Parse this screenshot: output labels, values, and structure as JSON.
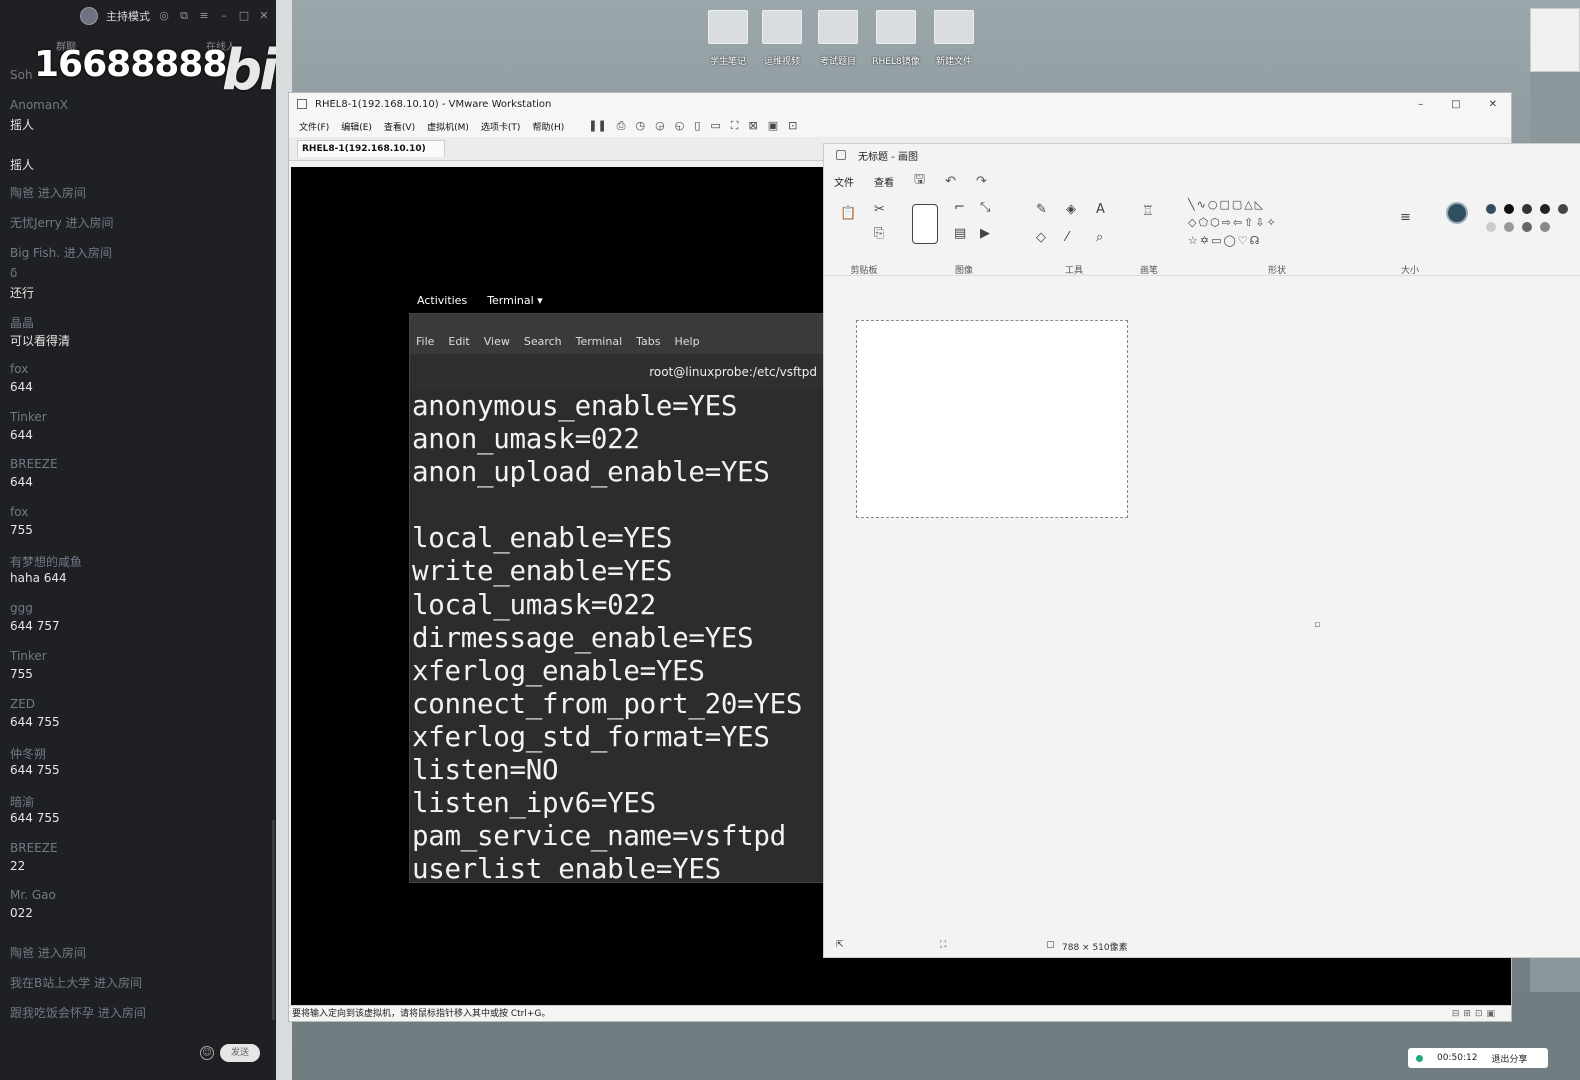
{
  "chat": {
    "header_mode": "主持模式",
    "subtabs": [
      "群聊",
      "在线人"
    ],
    "watermark_number": "16688888",
    "watermark_logo": "bilibili",
    "watermark_prefix": "Soh",
    "messages": [
      {
        "kind": "msg",
        "user": "AnomanX",
        "text": "摇人"
      },
      {
        "kind": "solo",
        "text": "摇人"
      },
      {
        "kind": "sys",
        "text": "陶爸 进入房间"
      },
      {
        "kind": "sys",
        "text": "无忧Jerry 进入房间"
      },
      {
        "kind": "sys",
        "text": "Big Fish. 进入房间"
      },
      {
        "kind": "msg",
        "user": "δ",
        "text": "还行"
      },
      {
        "kind": "msg",
        "user": "晶晶",
        "text": "可以看得清"
      },
      {
        "kind": "msg",
        "user": "fox",
        "text": "644"
      },
      {
        "kind": "msg",
        "user": "Tinker",
        "text": "644"
      },
      {
        "kind": "msg",
        "user": "BREEZE",
        "text": "644"
      },
      {
        "kind": "msg",
        "user": "fox",
        "text": "755"
      },
      {
        "kind": "msg",
        "user": "有梦想的咸鱼",
        "text": "haha 644"
      },
      {
        "kind": "msg",
        "user": "ggg",
        "text": "644 757"
      },
      {
        "kind": "msg",
        "user": "Tinker",
        "text": "755"
      },
      {
        "kind": "msg",
        "user": "ZED",
        "text": "644 755"
      },
      {
        "kind": "msg",
        "user": "仲冬朔",
        "text": "644  755"
      },
      {
        "kind": "msg",
        "user": "暗渝",
        "text": "644 755"
      },
      {
        "kind": "msg",
        "user": "BREEZE",
        "text": "22"
      },
      {
        "kind": "msg",
        "user": "Mr. Gao",
        "text": "022"
      },
      {
        "kind": "sys",
        "text": "陶爸 进入房间"
      },
      {
        "kind": "sys",
        "text": "我在B站上大学 进入房间"
      },
      {
        "kind": "sys",
        "text": "跟我吃饭会怀孕 进入房间"
      }
    ],
    "send_label": "发送"
  },
  "desktop_icons": [
    "学生笔记",
    "运维视频",
    "考试题目",
    "RHEL8镜像",
    "新建文件"
  ],
  "vmware": {
    "title": "RHEL8-1(192.168.10.10) - VMware Workstation",
    "menus": [
      "文件(F)",
      "编辑(E)",
      "查看(V)",
      "虚拟机(M)",
      "选项卡(T)",
      "帮助(H)"
    ],
    "tab": "RHEL8-1(192.168.10.10)",
    "status": "要将输入定向到该虚拟机，请将鼠标指针移入其中或按 Ctrl+G。"
  },
  "gnome": {
    "activities": "Activities",
    "app": "Terminal ▾"
  },
  "terminal": {
    "menus": [
      "File",
      "Edit",
      "View",
      "Search",
      "Terminal",
      "Tabs",
      "Help"
    ],
    "path": "root@linuxprobe:/etc/vsftpd",
    "lines": [
      "anonymous_enable=YES",
      "anon_umask=022",
      "anon_upload_enable=YES",
      "",
      "local_enable=YES",
      "write_enable=YES",
      "local_umask=022",
      "dirmessage_enable=YES",
      "xferlog_enable=YES",
      "connect_from_port_20=YES",
      "xferlog_std_format=YES",
      "listen=NO",
      "listen_ipv6=YES",
      "pam_service_name=vsftpd",
      "userlist_enable=YES"
    ]
  },
  "paint": {
    "title": "无标题 - 画图",
    "menus": [
      "文件",
      "查看"
    ],
    "groups": [
      "剪贴板",
      "图像",
      "工具",
      "画笔",
      "形状",
      "大小"
    ],
    "canvas_size": "788 × 510像素",
    "colors": [
      "#2f4f5f",
      "#111111",
      "#333333",
      "#222222",
      "#444444"
    ]
  },
  "share": {
    "time": "00:50:12",
    "stop_label": "退出分享"
  }
}
